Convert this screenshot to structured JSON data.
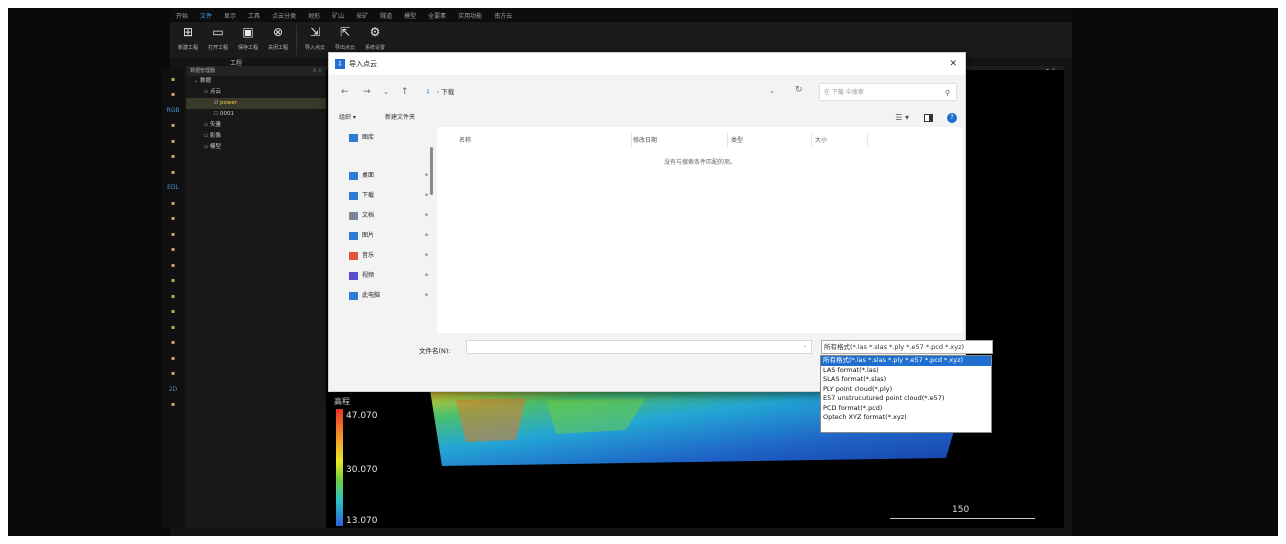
{
  "menubar": [
    "开始",
    "文件",
    "显示",
    "工具",
    "点云分类",
    "地形",
    "矿山",
    "采矿",
    "隧道",
    "模型",
    "全要素",
    "实用功能",
    "南方云"
  ],
  "menubar_active": 1,
  "ribbon": {
    "buttons": [
      {
        "label": "新建工程",
        "icon": "plus-icon"
      },
      {
        "label": "打开工程",
        "icon": "folder-icon"
      },
      {
        "label": "保存工程",
        "icon": "save-icon"
      },
      {
        "label": "关闭工程",
        "icon": "close-circle-icon"
      },
      {
        "label": "导入点云",
        "icon": "import-icon"
      },
      {
        "label": "导出点云",
        "icon": "export-icon"
      },
      {
        "label": "系统设置",
        "icon": "gear-icon"
      }
    ],
    "group_label": "工程"
  },
  "left_toolbar": [
    "",
    "",
    "RGB",
    "",
    "",
    "",
    "",
    "EDL",
    "",
    "",
    "",
    "",
    "",
    "",
    "",
    "",
    "",
    "",
    "",
    "",
    "2D",
    ""
  ],
  "project_panel": {
    "title": "数据管理器",
    "tree": [
      {
        "label": "数据",
        "level": 0
      },
      {
        "label": "点云",
        "level": 1
      },
      {
        "label": "power",
        "level": 2,
        "selected": true
      },
      {
        "label": "0001",
        "level": 2
      },
      {
        "label": "矢量",
        "level": 1
      },
      {
        "label": "影像",
        "level": 1
      },
      {
        "label": "模型",
        "level": 1
      }
    ]
  },
  "viewport": {
    "legend_title": "高程",
    "legend_values": [
      "47.070",
      "30.070",
      "13.070"
    ],
    "scale_label": "150"
  },
  "dialog": {
    "title": "导入点云",
    "breadcrumb": "下载",
    "search_placeholder": "在 下载 中搜索",
    "organize": "组织 ▾",
    "new_folder": "新建文件夹",
    "nav_items": [
      {
        "label": "图库",
        "pin": false
      },
      {
        "label": "桌面",
        "pin": true
      },
      {
        "label": "下载",
        "pin": true
      },
      {
        "label": "文档",
        "pin": true
      },
      {
        "label": "图片",
        "pin": true
      },
      {
        "label": "音乐",
        "pin": true
      },
      {
        "label": "视频",
        "pin": true
      },
      {
        "label": "此电脑",
        "pin": true
      }
    ],
    "columns": [
      "名称",
      "修改日期",
      "类型",
      "大小"
    ],
    "empty_text": "没有与搜索条件匹配的项。",
    "filename_label": "文件名(N):",
    "filter_selected": "所有格式(*.las *.slas *.ply *.e57 *.pcd *.xyz)",
    "filter_options": [
      "所有格式(*.las *.slas *.ply *.e57 *.pcd *.xyz)",
      "LAS format(*.las)",
      "SLAS format(*.slas)",
      "PLY point cloud(*.ply)",
      "E57 unstrucutured point cloud(*.e57)",
      "PCD format(*.pcd)",
      "Optech XYZ format(*.xyz)"
    ]
  }
}
